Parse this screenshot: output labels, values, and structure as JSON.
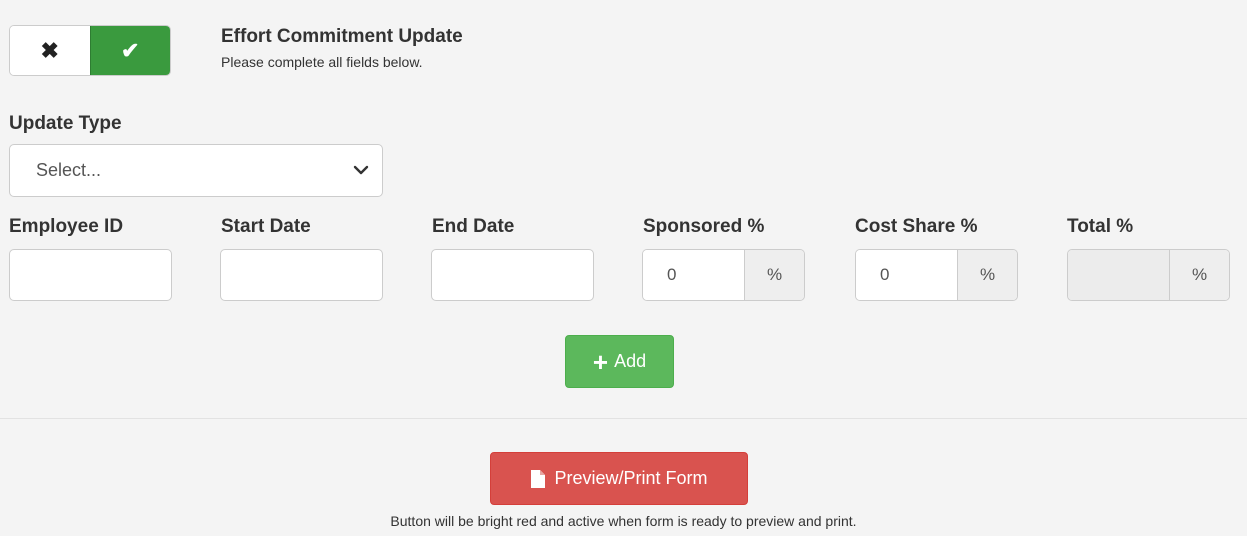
{
  "toggle": {
    "off_icon": "✖",
    "on_icon": "✔",
    "state": "on"
  },
  "header": {
    "title": "Effort Commitment Update",
    "subtitle": "Please complete all fields below."
  },
  "update_type": {
    "label": "Update Type",
    "value": "Select..."
  },
  "fields": {
    "employee_id": {
      "label": "Employee ID",
      "value": ""
    },
    "start_date": {
      "label": "Start Date",
      "value": ""
    },
    "end_date": {
      "label": "End Date",
      "value": ""
    },
    "sponsored": {
      "label": "Sponsored %",
      "value": "0",
      "addon": "%"
    },
    "cost_share": {
      "label": "Cost Share %",
      "value": "0",
      "addon": "%"
    },
    "total": {
      "label": "Total %",
      "value": "",
      "addon": "%"
    }
  },
  "add_button": {
    "icon": "+",
    "label": "Add"
  },
  "print_button": {
    "label": "Preview/Print Form"
  },
  "note": "Button will be bright red and active when form is ready to preview and print.",
  "colors": {
    "background": "#f4f4f4",
    "success": "#5cb85c",
    "toggle_on": "#3a9a3e",
    "danger": "#d9534f"
  }
}
